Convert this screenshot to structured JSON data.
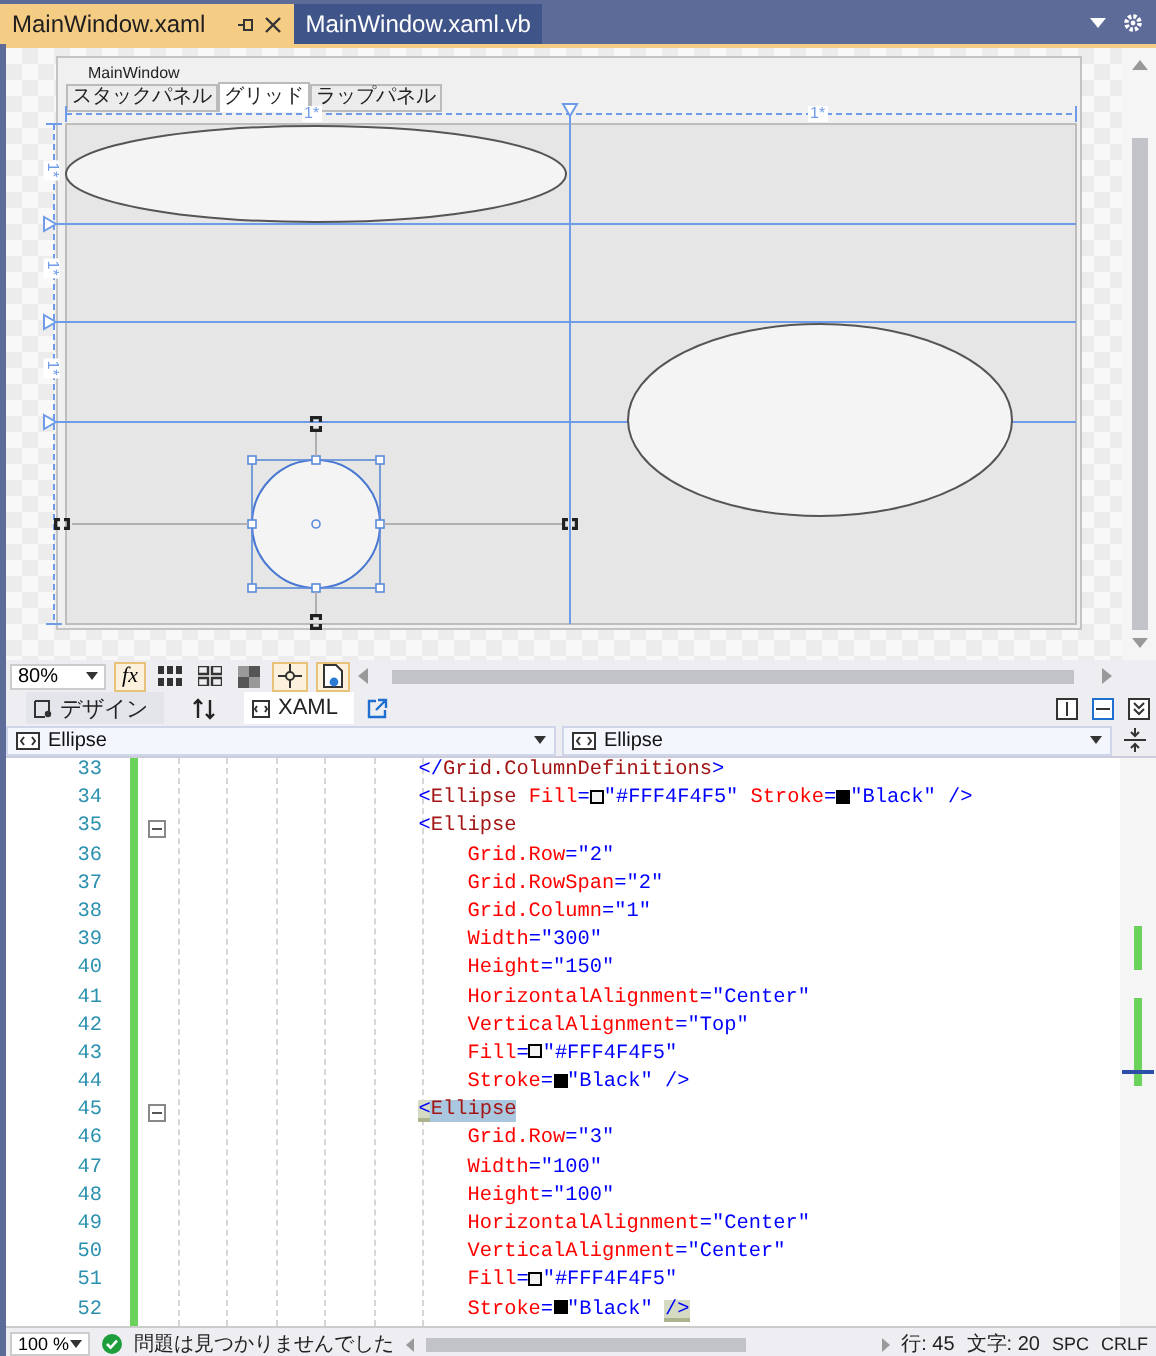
{
  "tabs": [
    {
      "label": "MainWindow.xaml",
      "selected": true
    },
    {
      "label": "MainWindow.xaml.vb",
      "selected": false
    }
  ],
  "designer": {
    "window_title": "MainWindow",
    "tabs": [
      {
        "label": "スタックパネル",
        "selected": false
      },
      {
        "label": "グリッド",
        "selected": true
      },
      {
        "label": "ラップパネル",
        "selected": false
      }
    ],
    "column_widths": [
      "1*",
      "1*"
    ],
    "row_heights": [
      "1*",
      "1*",
      "1*"
    ],
    "shapes": [
      {
        "kind": "ellipse",
        "selected": false
      },
      {
        "kind": "ellipse",
        "selected": false
      },
      {
        "kind": "ellipse",
        "selected": true
      }
    ]
  },
  "toolbar": {
    "zoom": "80%",
    "formula_button": "fx"
  },
  "view_tabs": [
    {
      "label": "デザイン",
      "selected": false
    },
    {
      "label": "XAML",
      "selected": true
    }
  ],
  "nav": [
    "Ellipse",
    "Ellipse"
  ],
  "code": [
    {
      "number": "33",
      "collapsible": false,
      "tokens": [
        {
          "kind": "delim",
          "text": "                    </"
        },
        {
          "kind": "element",
          "text": "Grid.ColumnDefinitions"
        },
        {
          "kind": "delim",
          "text": ">"
        }
      ]
    },
    {
      "number": "34",
      "collapsible": false,
      "tokens": [
        {
          "kind": "delim",
          "text": "                    <"
        },
        {
          "kind": "element",
          "text": "Ellipse"
        },
        {
          "kind": "attribute",
          "text": " Fill"
        },
        {
          "kind": "value",
          "text": "="
        },
        {
          "kind": "swatch",
          "color": "#f4f4f5"
        },
        {
          "kind": "value",
          "text": "\"#FFF4F4F5\""
        },
        {
          "kind": "attribute",
          "text": " Stroke"
        },
        {
          "kind": "value",
          "text": "="
        },
        {
          "kind": "swatch",
          "color": "#000000"
        },
        {
          "kind": "value",
          "text": "\"Black\""
        },
        {
          "kind": "delim",
          "text": " />"
        }
      ]
    },
    {
      "number": "35",
      "collapsible": true,
      "tokens": [
        {
          "kind": "delim",
          "text": "                    <"
        },
        {
          "kind": "element",
          "text": "Ellipse"
        }
      ]
    },
    {
      "number": "36",
      "collapsible": false,
      "tokens": [
        {
          "kind": "attribute",
          "text": "                        Grid.Row"
        },
        {
          "kind": "value",
          "text": "=\"2\""
        }
      ]
    },
    {
      "number": "37",
      "collapsible": false,
      "tokens": [
        {
          "kind": "attribute",
          "text": "                        Grid.RowSpan"
        },
        {
          "kind": "value",
          "text": "=\"2\""
        }
      ]
    },
    {
      "number": "38",
      "collapsible": false,
      "tokens": [
        {
          "kind": "attribute",
          "text": "                        Grid.Column"
        },
        {
          "kind": "value",
          "text": "=\"1\""
        }
      ]
    },
    {
      "number": "39",
      "collapsible": false,
      "tokens": [
        {
          "kind": "attribute",
          "text": "                        Width"
        },
        {
          "kind": "value",
          "text": "=\"300\""
        }
      ]
    },
    {
      "number": "40",
      "collapsible": false,
      "tokens": [
        {
          "kind": "attribute",
          "text": "                        Height"
        },
        {
          "kind": "value",
          "text": "=\"150\""
        }
      ]
    },
    {
      "number": "41",
      "collapsible": false,
      "tokens": [
        {
          "kind": "attribute",
          "text": "                        HorizontalAlignment"
        },
        {
          "kind": "value",
          "text": "=\"Center\""
        }
      ]
    },
    {
      "number": "42",
      "collapsible": false,
      "tokens": [
        {
          "kind": "attribute",
          "text": "                        VerticalAlignment"
        },
        {
          "kind": "value",
          "text": "=\"Top\""
        }
      ]
    },
    {
      "number": "43",
      "collapsible": false,
      "tokens": [
        {
          "kind": "attribute",
          "text": "                        Fill"
        },
        {
          "kind": "value",
          "text": "="
        },
        {
          "kind": "swatch",
          "color": "#f4f4f5"
        },
        {
          "kind": "value",
          "text": "\"#FFF4F4F5\""
        }
      ]
    },
    {
      "number": "44",
      "collapsible": false,
      "tokens": [
        {
          "kind": "attribute",
          "text": "                        Stroke"
        },
        {
          "kind": "value",
          "text": "="
        },
        {
          "kind": "swatch",
          "color": "#000000"
        },
        {
          "kind": "value",
          "text": "\"Black\""
        },
        {
          "kind": "delim",
          "text": " />"
        }
      ]
    },
    {
      "number": "45",
      "collapsible": true,
      "tokens": [
        {
          "kind": "delim",
          "text": "                    <",
          "brace_match": true,
          "selected": false
        },
        {
          "kind": "element",
          "text": "Ellipse",
          "brace_match": false,
          "selected": true
        }
      ]
    },
    {
      "number": "46",
      "collapsible": false,
      "tokens": [
        {
          "kind": "attribute",
          "text": "                        Grid.Row"
        },
        {
          "kind": "value",
          "text": "=\"3\""
        }
      ]
    },
    {
      "number": "47",
      "collapsible": false,
      "tokens": [
        {
          "kind": "attribute",
          "text": "                        Width"
        },
        {
          "kind": "value",
          "text": "=\"100\""
        }
      ]
    },
    {
      "number": "48",
      "collapsible": false,
      "tokens": [
        {
          "kind": "attribute",
          "text": "                        Height"
        },
        {
          "kind": "value",
          "text": "=\"100\""
        }
      ]
    },
    {
      "number": "49",
      "collapsible": false,
      "tokens": [
        {
          "kind": "attribute",
          "text": "                        HorizontalAlignment"
        },
        {
          "kind": "value",
          "text": "=\"Center\""
        }
      ]
    },
    {
      "number": "50",
      "collapsible": false,
      "tokens": [
        {
          "kind": "attribute",
          "text": "                        VerticalAlignment"
        },
        {
          "kind": "value",
          "text": "=\"Center\""
        }
      ]
    },
    {
      "number": "51",
      "collapsible": false,
      "tokens": [
        {
          "kind": "attribute",
          "text": "                        Fill"
        },
        {
          "kind": "value",
          "text": "="
        },
        {
          "kind": "swatch",
          "color": "#f4f4f5"
        },
        {
          "kind": "value",
          "text": "\"#FFF4F4F5\""
        }
      ]
    },
    {
      "number": "52",
      "collapsible": false,
      "tokens": [
        {
          "kind": "attribute",
          "text": "                        Stroke",
          "brace_match": false,
          "selected": false
        },
        {
          "kind": "value",
          "text": "=",
          "brace_match": false,
          "selected": false
        },
        {
          "kind": "swatch",
          "color": "#000000"
        },
        {
          "kind": "value",
          "text": "\"Black\" ",
          "brace_match": false,
          "selected": false
        },
        {
          "kind": "delim",
          "text": "/>",
          "brace_match": true,
          "selected": false
        }
      ]
    }
  ],
  "status": {
    "zoom": "100 %",
    "issues": "問題は見つかりませんでした",
    "line": "行: 45",
    "column": "文字: 20",
    "whitespace": "SPC",
    "line_ending": "CRLF"
  }
}
